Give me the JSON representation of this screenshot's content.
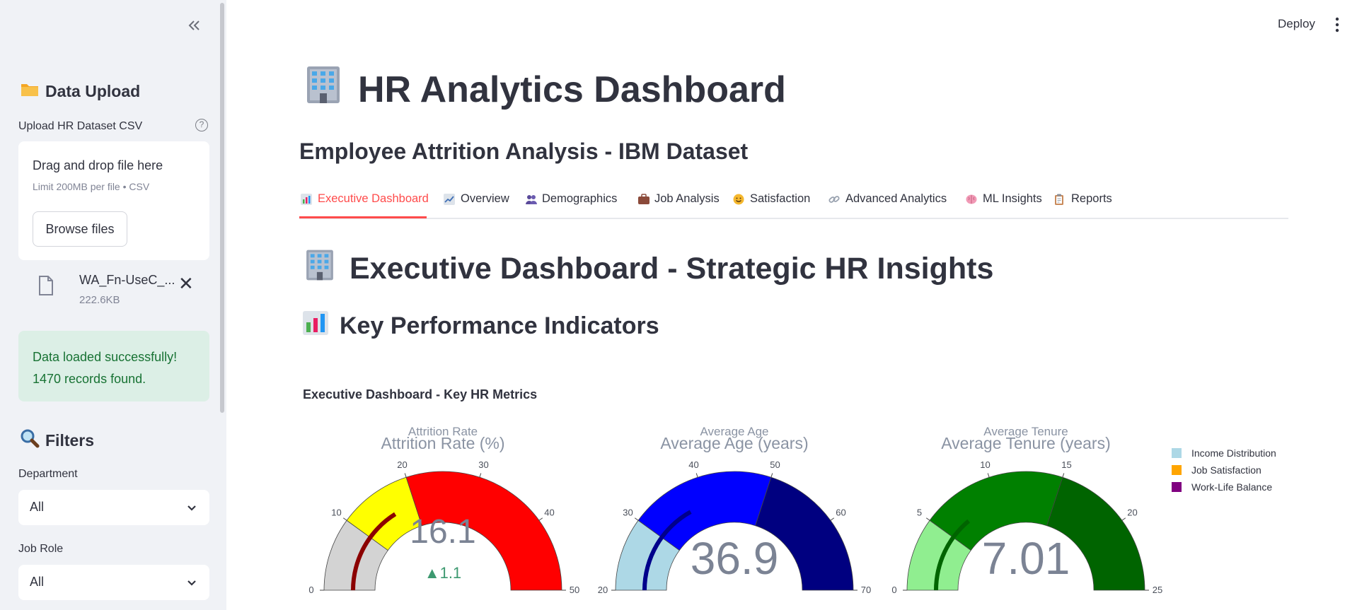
{
  "sidebar": {
    "upload_heading": "Data Upload",
    "upload_label": "Upload HR Dataset CSV",
    "dropzone_title": "Drag and drop file here",
    "dropzone_limit": "Limit 200MB per file • CSV",
    "browse_label": "Browse files",
    "file_name": "WA_Fn-UseC_...",
    "file_size": "222.6KB",
    "success_line1": "Data loaded successfully!",
    "success_line2": "1470 records found.",
    "filters_heading": "Filters",
    "department_label": "Department",
    "department_value": "All",
    "jobrole_label": "Job Role",
    "jobrole_value": "All"
  },
  "header": {
    "deploy_label": "Deploy"
  },
  "main": {
    "title": "HR Analytics Dashboard",
    "subtitle": "Employee Attrition Analysis - IBM Dataset",
    "tabs": [
      {
        "label": "Executive Dashboard",
        "icon": "bar-chart-icon",
        "active": true
      },
      {
        "label": "Overview",
        "icon": "line-chart-icon"
      },
      {
        "label": "Demographics",
        "icon": "people-icon"
      },
      {
        "label": "Job Analysis",
        "icon": "briefcase-icon"
      },
      {
        "label": "Satisfaction",
        "icon": "smile-icon"
      },
      {
        "label": "Advanced Analytics",
        "icon": "link-icon"
      },
      {
        "label": "ML Insights",
        "icon": "brain-icon"
      },
      {
        "label": "Reports",
        "icon": "clipboard-icon"
      }
    ],
    "section_heading": "Executive Dashboard - Strategic HR Insights",
    "kpi_heading": "Key Performance Indicators",
    "chart_title": "Executive Dashboard - Key HR Metrics"
  },
  "colors": {
    "accent": "#ff4b4b",
    "success_bg": "#dcefe6",
    "success_text": "#177233",
    "sidebar_bg": "#f0f2f6"
  },
  "chart_data": {
    "type": "gauge",
    "title": "Executive Dashboard - Key HR Metrics",
    "legend": {
      "placement": "right",
      "entries": [
        {
          "name": "Income Distribution",
          "color": "#add8e6"
        },
        {
          "name": "Job Satisfaction",
          "color": "#ffa500"
        },
        {
          "name": "Work-Life Balance",
          "color": "#800080"
        }
      ]
    },
    "gauges": [
      {
        "small_title": "Attrition Rate",
        "title": "Attrition Rate (%)",
        "value": 16.1,
        "value_label": "16.1",
        "delta_label": "▲1.1",
        "range": [
          0,
          50
        ],
        "ticks": [
          0,
          10,
          20,
          30,
          40,
          50
        ],
        "bar_color": "#8b0000",
        "steps": [
          {
            "range": [
              0,
              10
            ],
            "color": "#d3d3d3"
          },
          {
            "range": [
              10,
              20
            ],
            "color": "#ffff00"
          },
          {
            "range": [
              20,
              50
            ],
            "color": "#ff0000"
          }
        ]
      },
      {
        "small_title": "Average Age",
        "title": "Average Age (years)",
        "value": 36.9,
        "value_label": "36.9",
        "range": [
          20,
          70
        ],
        "ticks": [
          20,
          30,
          40,
          50,
          60,
          70
        ],
        "bar_color": "#00008b",
        "steps": [
          {
            "range": [
              20,
              30
            ],
            "color": "#add8e6"
          },
          {
            "range": [
              30,
              50
            ],
            "color": "#0000ff"
          },
          {
            "range": [
              50,
              70
            ],
            "color": "#000080"
          }
        ]
      },
      {
        "small_title": "Average Tenure",
        "title": "Average Tenure (years)",
        "value": 7.01,
        "value_label": "7.01",
        "range": [
          0,
          25
        ],
        "ticks": [
          0,
          5,
          10,
          15,
          20,
          25
        ],
        "bar_color": "#006400",
        "steps": [
          {
            "range": [
              0,
              5
            ],
            "color": "#90ee90"
          },
          {
            "range": [
              5,
              15
            ],
            "color": "#008000"
          },
          {
            "range": [
              15,
              25
            ],
            "color": "#006400"
          }
        ]
      }
    ]
  }
}
